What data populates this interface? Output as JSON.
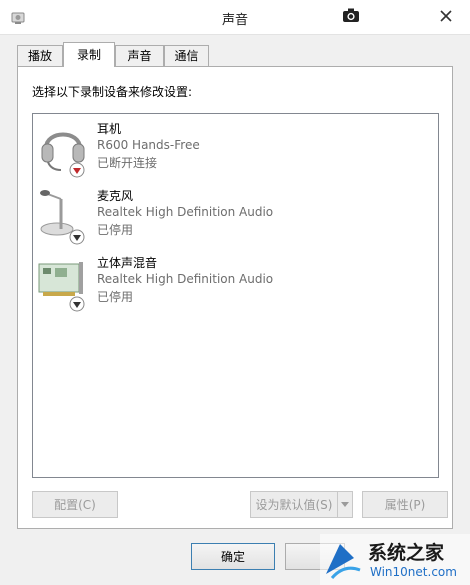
{
  "window": {
    "title": "声音"
  },
  "tabs": [
    {
      "label": "播放"
    },
    {
      "label": "录制"
    },
    {
      "label": "声音"
    },
    {
      "label": "通信"
    }
  ],
  "instruction": "选择以下录制设备来修改设置:",
  "devices": [
    {
      "name": "耳机",
      "description": "R600 Hands-Free",
      "status": "已断开连接",
      "icon": "headset-icon",
      "badge": "disconnected-badge"
    },
    {
      "name": "麦克风",
      "description": "Realtek High Definition Audio",
      "status": "已停用",
      "icon": "microphone-icon",
      "badge": "disabled-badge"
    },
    {
      "name": "立体声混音",
      "description": "Realtek High Definition Audio",
      "status": "已停用",
      "icon": "sound-card-icon",
      "badge": "disabled-badge"
    }
  ],
  "buttons": {
    "configure": "配置(C)",
    "set_default": "设为默认值(S)",
    "properties": "属性(P)",
    "ok": "确定",
    "cancel": ""
  },
  "watermark": {
    "brand": "系统之家",
    "url": "Win10net.com"
  },
  "colors": {
    "accent_red": "#c0282b",
    "disabled_gray": "#9b9b9b",
    "logo_blue": "#1f6fc6"
  }
}
